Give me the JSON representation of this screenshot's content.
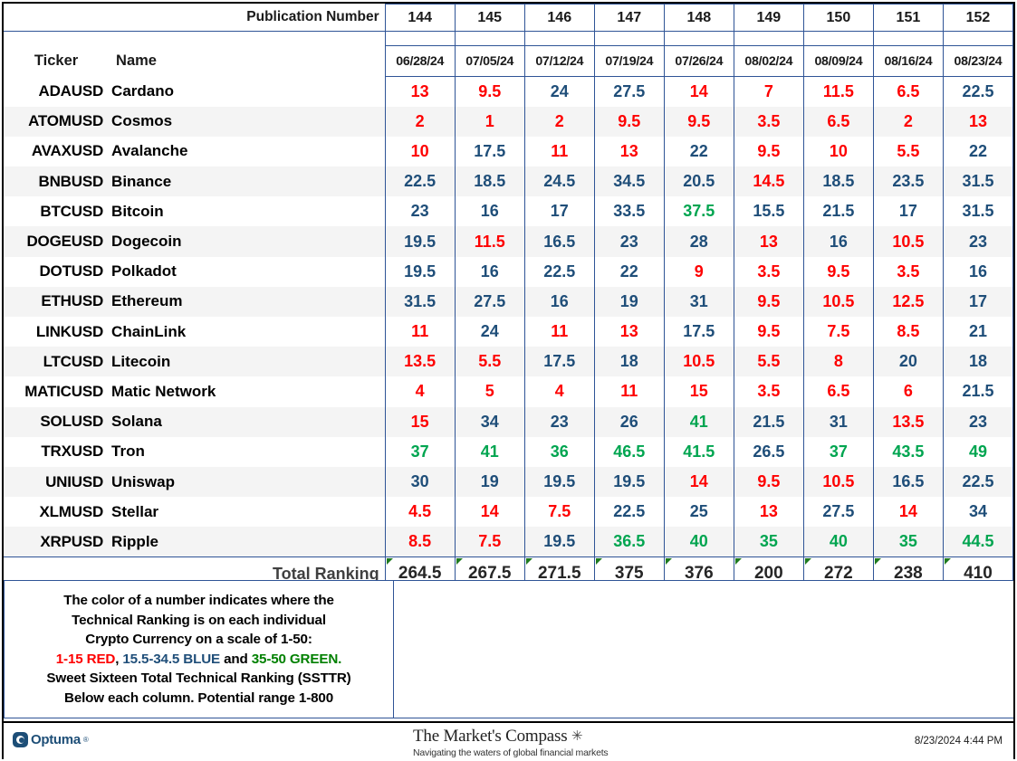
{
  "header": {
    "publication_number_label": "Publication Number",
    "ticker_label": "Ticker",
    "name_label": "Name",
    "publication_numbers": [
      "144",
      "145",
      "146",
      "147",
      "148",
      "149",
      "150",
      "151",
      "152"
    ],
    "dates": [
      "06/28/24",
      "07/05/24",
      "07/12/24",
      "07/19/24",
      "07/26/24",
      "08/02/24",
      "08/09/24",
      "08/16/24",
      "08/23/24"
    ]
  },
  "colors": {
    "red": "#fe0000",
    "blue": "#1f4e79",
    "green": "#00a550",
    "grid": "#2f5496",
    "legend_green": "#008000",
    "brand": "#1d4e77"
  },
  "chart_data": {
    "type": "table",
    "title": "Crypto Technical Ranking — Sweet Sixteen Total Technical Ranking (SSTTR)",
    "columns": [
      "Ticker",
      "Name",
      "06/28/24",
      "07/05/24",
      "07/12/24",
      "07/19/24",
      "07/26/24",
      "08/02/24",
      "08/09/24",
      "08/16/24",
      "08/23/24"
    ],
    "publication_numbers": [
      144,
      145,
      146,
      147,
      148,
      149,
      150,
      151,
      152
    ],
    "scale": [
      1,
      50
    ],
    "color_rules": [
      {
        "range": "1-15",
        "color": "red"
      },
      {
        "range": "15.5-34.5",
        "color": "blue"
      },
      {
        "range": "35-50",
        "color": "green"
      }
    ],
    "rows": [
      {
        "ticker": "ADAUSD",
        "name": "Cardano",
        "values": [
          13,
          9.5,
          24,
          27.5,
          14,
          7,
          11.5,
          6.5,
          22.5
        ],
        "colors": [
          "red",
          "red",
          "blue",
          "blue",
          "red",
          "red",
          "red",
          "red",
          "blue"
        ]
      },
      {
        "ticker": "ATOMUSD",
        "name": "Cosmos",
        "values": [
          2,
          1,
          2,
          9.5,
          9.5,
          3.5,
          6.5,
          2,
          13
        ],
        "colors": [
          "red",
          "red",
          "red",
          "red",
          "red",
          "red",
          "red",
          "red",
          "red"
        ]
      },
      {
        "ticker": "AVAXUSD",
        "name": "Avalanche",
        "values": [
          10,
          17.5,
          11,
          13,
          22,
          9.5,
          10,
          5.5,
          22
        ],
        "colors": [
          "red",
          "blue",
          "red",
          "red",
          "blue",
          "red",
          "red",
          "red",
          "blue"
        ]
      },
      {
        "ticker": "BNBUSD",
        "name": "Binance",
        "values": [
          22.5,
          18.5,
          24.5,
          34.5,
          20.5,
          14.5,
          18.5,
          23.5,
          31.5
        ],
        "colors": [
          "blue",
          "blue",
          "blue",
          "blue",
          "blue",
          "red",
          "blue",
          "blue",
          "blue"
        ]
      },
      {
        "ticker": "BTCUSD",
        "name": "Bitcoin",
        "values": [
          23,
          16,
          17,
          33.5,
          37.5,
          15.5,
          21.5,
          17,
          31.5
        ],
        "colors": [
          "blue",
          "blue",
          "blue",
          "blue",
          "green",
          "blue",
          "blue",
          "blue",
          "blue"
        ]
      },
      {
        "ticker": "DOGEUSD",
        "name": "Dogecoin",
        "values": [
          19.5,
          11.5,
          16.5,
          23,
          28,
          13,
          16,
          10.5,
          23
        ],
        "colors": [
          "blue",
          "red",
          "blue",
          "blue",
          "blue",
          "red",
          "blue",
          "red",
          "blue"
        ]
      },
      {
        "ticker": "DOTUSD",
        "name": "Polkadot",
        "values": [
          19.5,
          16,
          22.5,
          22,
          9,
          3.5,
          9.5,
          3.5,
          16
        ],
        "colors": [
          "blue",
          "blue",
          "blue",
          "blue",
          "red",
          "red",
          "red",
          "red",
          "blue"
        ]
      },
      {
        "ticker": "ETHUSD",
        "name": "Ethereum",
        "values": [
          31.5,
          27.5,
          16,
          19,
          31,
          9.5,
          10.5,
          12.5,
          17
        ],
        "colors": [
          "blue",
          "blue",
          "blue",
          "blue",
          "blue",
          "red",
          "red",
          "red",
          "blue"
        ]
      },
      {
        "ticker": "LINKUSD",
        "name": "ChainLink",
        "values": [
          11,
          24,
          11,
          13,
          17.5,
          9.5,
          7.5,
          8.5,
          21
        ],
        "colors": [
          "red",
          "blue",
          "red",
          "red",
          "blue",
          "red",
          "red",
          "red",
          "blue"
        ]
      },
      {
        "ticker": "LTCUSD",
        "name": "Litecoin",
        "values": [
          13.5,
          5.5,
          17.5,
          18,
          10.5,
          5.5,
          8,
          20,
          18
        ],
        "colors": [
          "red",
          "red",
          "blue",
          "blue",
          "red",
          "red",
          "red",
          "blue",
          "blue"
        ]
      },
      {
        "ticker": "MATICUSD",
        "name": "Matic Network",
        "values": [
          4,
          5,
          4,
          11,
          15,
          3.5,
          6.5,
          6,
          21.5
        ],
        "colors": [
          "red",
          "red",
          "red",
          "red",
          "red",
          "red",
          "red",
          "red",
          "blue"
        ]
      },
      {
        "ticker": "SOLUSD",
        "name": "Solana",
        "values": [
          15,
          34,
          23,
          26,
          41,
          21.5,
          31,
          13.5,
          23
        ],
        "colors": [
          "red",
          "blue",
          "blue",
          "blue",
          "green",
          "blue",
          "blue",
          "red",
          "blue"
        ]
      },
      {
        "ticker": "TRXUSD",
        "name": "Tron",
        "values": [
          37,
          41,
          36,
          46.5,
          41.5,
          26.5,
          37,
          43.5,
          49
        ],
        "colors": [
          "green",
          "green",
          "green",
          "green",
          "green",
          "blue",
          "green",
          "green",
          "green"
        ]
      },
      {
        "ticker": "UNIUSD",
        "name": "Uniswap",
        "values": [
          30,
          19,
          19.5,
          19.5,
          14,
          9.5,
          10.5,
          16.5,
          22.5
        ],
        "colors": [
          "blue",
          "blue",
          "blue",
          "blue",
          "red",
          "red",
          "red",
          "blue",
          "blue"
        ]
      },
      {
        "ticker": "XLMUSD",
        "name": "Stellar",
        "values": [
          4.5,
          14,
          7.5,
          22.5,
          25,
          13,
          27.5,
          14,
          34
        ],
        "colors": [
          "red",
          "red",
          "red",
          "blue",
          "blue",
          "red",
          "blue",
          "red",
          "blue"
        ]
      },
      {
        "ticker": "XRPUSD",
        "name": "Ripple",
        "values": [
          8.5,
          7.5,
          19.5,
          36.5,
          40,
          35,
          40,
          35,
          44.5
        ],
        "colors": [
          "red",
          "red",
          "blue",
          "green",
          "green",
          "green",
          "green",
          "green",
          "green"
        ]
      }
    ],
    "total_label": "Total Ranking",
    "totals": [
      264.5,
      267.5,
      271.5,
      375,
      376,
      200,
      272,
      238,
      410
    ]
  },
  "legend": {
    "line1": "The color of a number indicates where the",
    "line2": "Technical Ranking is on each individual",
    "line3": "Crypto Currency on a scale of 1-50:",
    "line4_red": "1-15 RED",
    "line4_sep1": ", ",
    "line4_blue": "15.5-34.5 BLUE",
    "line4_sep2": " and ",
    "line4_green": "35-50 GREEN.",
    "line5": "Sweet Sixteen Total Technical Ranking (SSTTR)",
    "line6": "Below each column.   Potential range 1-800"
  },
  "footer": {
    "logo_text": "Optuma",
    "logo_tm": "®",
    "brand_title": "The Market's Compass",
    "brand_subtitle": "Navigating the waters of global financial markets",
    "timestamp": "8/23/2024 4:44 PM"
  }
}
